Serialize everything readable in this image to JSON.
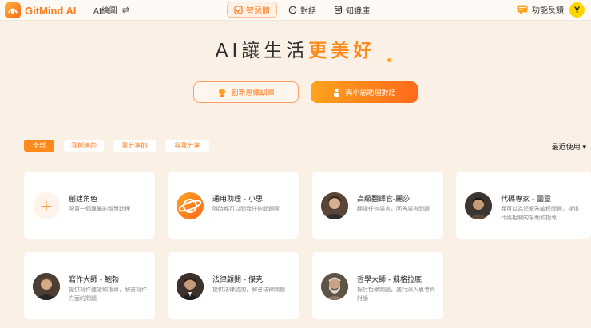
{
  "app": {
    "name": "GitMind AI",
    "mode_label": "AI繪圖"
  },
  "nav": [
    {
      "label": "智慧體",
      "active": true
    },
    {
      "label": "對話",
      "active": false
    },
    {
      "label": "知識庫",
      "active": false
    }
  ],
  "header": {
    "feedback_label": "功能反饋",
    "avatar_letter": "Y"
  },
  "hero": {
    "title_main": "AI讓生活",
    "title_accent": "更美好"
  },
  "cta": {
    "outline_label": "創新思維訓練",
    "solid_label": "與小思助理對話"
  },
  "filters": [
    {
      "label": "全部",
      "active": true
    },
    {
      "label": "我創建的",
      "active": false
    },
    {
      "label": "我分享的",
      "active": false
    },
    {
      "label": "與我分享",
      "active": false
    }
  ],
  "sort": {
    "label": "最近使用 ▾"
  },
  "cards": [
    {
      "title": "創建角色",
      "desc": "配置一個專屬的智慧助理",
      "icon": "plus-icon"
    },
    {
      "title": "通用助理 - 小思",
      "desc": "隨時都可以問我任何問題喔",
      "icon": "planet-icon"
    },
    {
      "title": "高級翻譯官-麗莎",
      "desc": "翻譯任何語言，回答語言問題",
      "icon": "avatar-photo"
    },
    {
      "title": "代碼專家 - 圖靈",
      "desc": "我可以為您解答編程問題，提供代碼相關的幫助和指導",
      "icon": "avatar-photo"
    },
    {
      "title": "寫作大師 - 鮑勃",
      "desc": "提供寫作建議和指導，解答寫作方面的問題",
      "icon": "avatar-photo"
    },
    {
      "title": "法律顧問 - 傑克",
      "desc": "提供法律諮詢，解答法律問題",
      "icon": "avatar-photo"
    },
    {
      "title": "哲學大師 - 蘇格拉底",
      "desc": "探討哲學問題，進行深入思考與討論",
      "icon": "avatar-photo"
    }
  ],
  "colors": {
    "accent": "#ff8a1c",
    "background": "#fbf0e6"
  }
}
